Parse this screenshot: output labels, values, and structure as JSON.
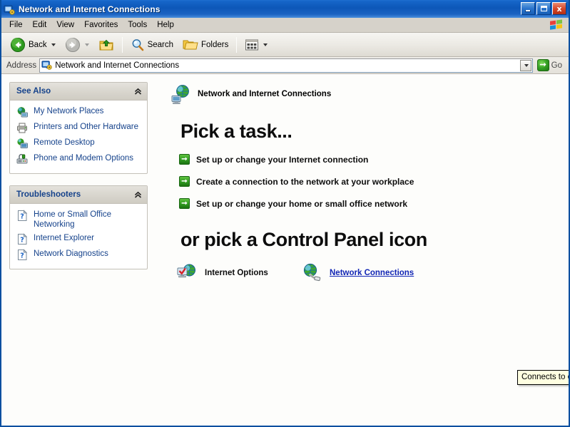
{
  "window": {
    "title": "Network and Internet Connections",
    "title_icon": "network-connections-icon",
    "controls": {
      "minimize_label": "Minimize",
      "maximize_label": "Maximize",
      "close_label": "x"
    }
  },
  "menubar": {
    "items": [
      {
        "label": "File",
        "name": "menu-file"
      },
      {
        "label": "Edit",
        "name": "menu-edit"
      },
      {
        "label": "View",
        "name": "menu-view"
      },
      {
        "label": "Favorites",
        "name": "menu-favorites"
      },
      {
        "label": "Tools",
        "name": "menu-tools"
      },
      {
        "label": "Help",
        "name": "menu-help"
      }
    ],
    "brand_icon": "windows-flag-icon"
  },
  "toolbar": {
    "back_label": "Back",
    "forward_label": "",
    "up_label": "",
    "search_label": "Search",
    "folders_label": "Folders",
    "views_label": ""
  },
  "address": {
    "label": "Address",
    "value": "Network and Internet Connections",
    "icon": "network-connections-icon",
    "go_label": "Go"
  },
  "sidebar": {
    "panels": [
      {
        "title": "See Also",
        "name": "see-also-panel",
        "collapse_glyph": "«",
        "items": [
          {
            "label": "My Network Places",
            "icon": "network-places-icon"
          },
          {
            "label": "Printers and Other Hardware",
            "icon": "printer-icon"
          },
          {
            "label": "Remote Desktop",
            "icon": "remote-desktop-icon"
          },
          {
            "label": "Phone and Modem Options",
            "icon": "modem-icon"
          }
        ]
      },
      {
        "title": "Troubleshooters",
        "name": "troubleshooters-panel",
        "collapse_glyph": "«",
        "items": [
          {
            "label": "Home or Small Office Networking",
            "icon": "help-icon"
          },
          {
            "label": "Internet Explorer",
            "icon": "help-icon"
          },
          {
            "label": "Network Diagnostics",
            "icon": "help-icon"
          }
        ]
      }
    ]
  },
  "main": {
    "header_title": "Network and Internet Connections",
    "header_icon": "network-globe-icon",
    "pick_task_heading": "Pick a task...",
    "tasks": [
      {
        "label": "Set up or change your Internet connection"
      },
      {
        "label": "Create a connection to the network at your workplace"
      },
      {
        "label": "Set up or change your home or small office network"
      }
    ],
    "control_panel_heading": "or pick a Control Panel icon",
    "control_panel_icons": [
      {
        "label": "Internet Options",
        "icon": "internet-options-icon",
        "hovered": false
      },
      {
        "label": "Network Connections",
        "icon": "network-connections-icon",
        "hovered": true
      }
    ]
  },
  "tooltip": {
    "text": "Connects to other computers, networks, and the Internet."
  },
  "colors": {
    "titlebar_blue": "#0d57b8",
    "link_blue": "#15428b",
    "hover_link": "#1226b5",
    "accent_green": "#2f9a20",
    "tooltip_bg": "#ffffe1",
    "panel_bg": "#fdfdfb"
  }
}
